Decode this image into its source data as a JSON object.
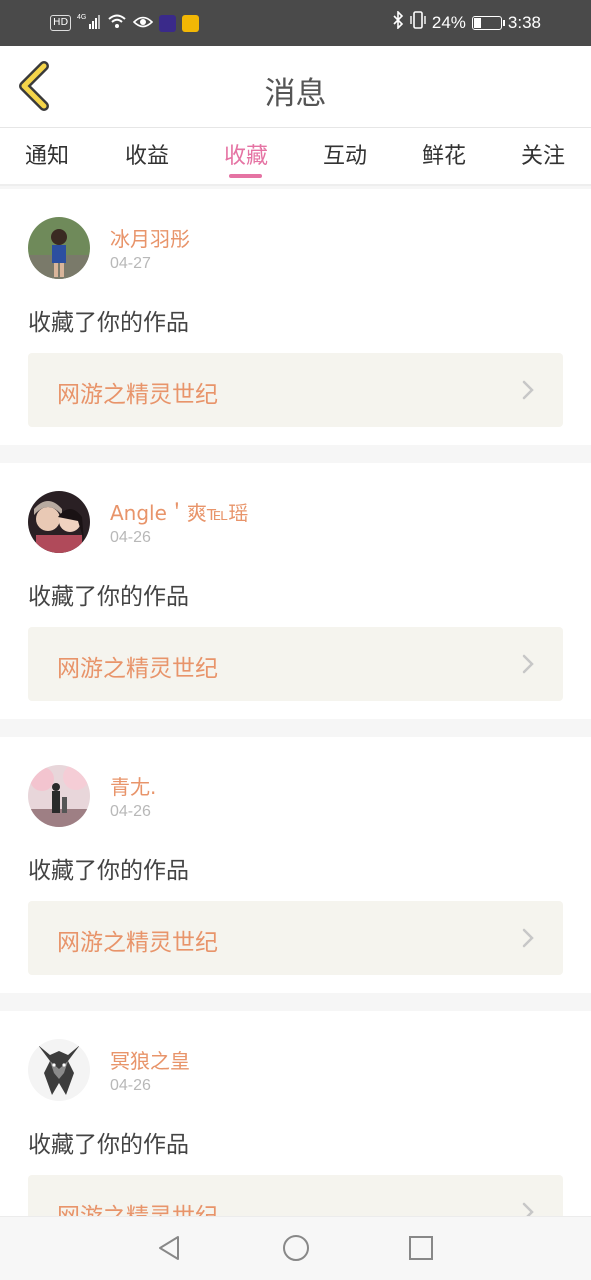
{
  "status_bar": {
    "hd": "HD",
    "network": "4G",
    "battery": "24%",
    "battery_fraction": 0.24,
    "time": "3:38",
    "icons": [
      "signal-icon",
      "wifi-icon",
      "eye-icon",
      "app-icon",
      "weibo-icon",
      "bluetooth-icon",
      "vibrate-icon",
      "battery-icon"
    ]
  },
  "header": {
    "title": "消息",
    "back_icon": "back-chevron-icon"
  },
  "tabs": [
    {
      "label": "通知"
    },
    {
      "label": "收益"
    },
    {
      "label": "收藏",
      "active": true
    },
    {
      "label": "互动"
    },
    {
      "label": "鲜花"
    },
    {
      "label": "关注"
    }
  ],
  "accent_color": "#e573a3",
  "name_color": "#e8946a",
  "items": [
    {
      "user": "冰月羽彤",
      "date": "04-27",
      "action": "收藏了你的作品",
      "work": "网游之精灵世纪"
    },
    {
      "user": "Angle＇爽℡瑶",
      "date": "04-26",
      "action": "收藏了你的作品",
      "work": "网游之精灵世纪"
    },
    {
      "user": "青尢.",
      "date": "04-26",
      "action": "收藏了你的作品",
      "work": "网游之精灵世纪"
    },
    {
      "user": "冥狼之皇",
      "date": "04-26",
      "action": "收藏了你的作品",
      "work": "网游之精灵世纪"
    }
  ],
  "nav_bar": {
    "icons": [
      "back-triangle-icon",
      "home-circle-icon",
      "recents-square-icon"
    ]
  }
}
